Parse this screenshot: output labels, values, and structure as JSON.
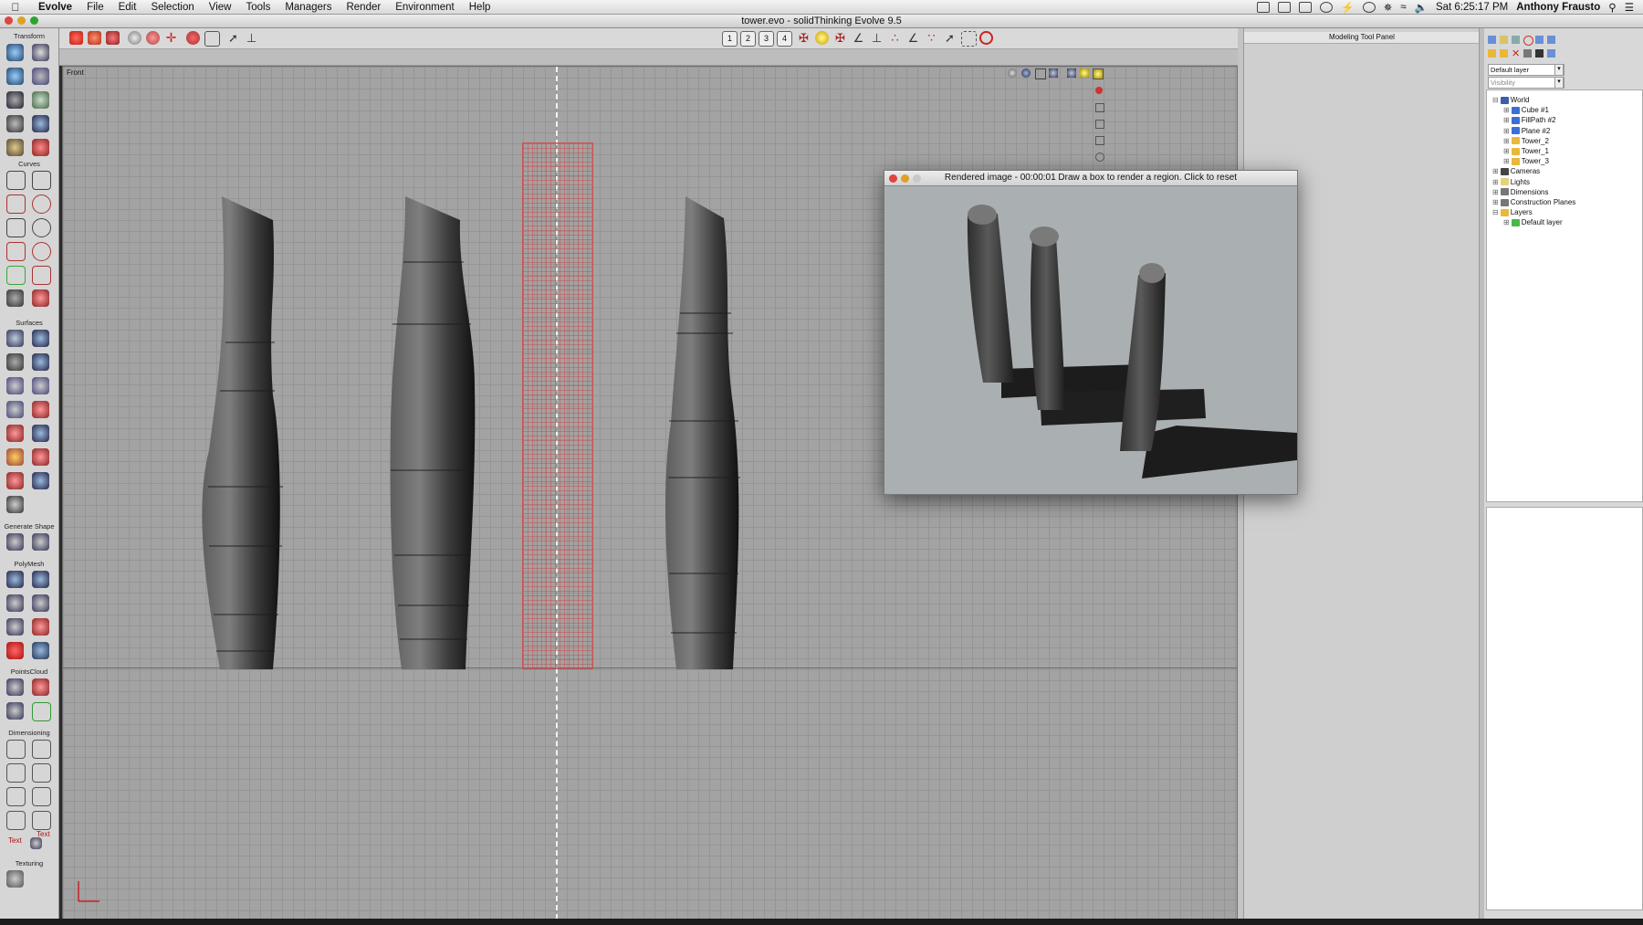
{
  "menubar": {
    "app_name": "Evolve",
    "items": [
      "File",
      "Edit",
      "Selection",
      "View",
      "Tools",
      "Managers",
      "Render",
      "Environment",
      "Help"
    ],
    "clock": "Sat 6:25:17 PM",
    "user": "Anthony Frausto"
  },
  "window": {
    "title": "tower.evo - solidThinking Evolve 9.5"
  },
  "toolbar": {
    "view_numbers": [
      "1",
      "2",
      "3",
      "4"
    ]
  },
  "left_panel": {
    "sections": [
      "Transform",
      "Curves",
      "Surfaces",
      "Generate Shape",
      "PolyMesh",
      "PointsCloud",
      "Dimensioning",
      "Texturing"
    ],
    "text_labels": [
      "Text",
      "Text"
    ]
  },
  "viewport": {
    "label": "Front"
  },
  "modeling_panel": {
    "title": "Modeling Tool Panel"
  },
  "browser": {
    "layer_select": "Default layer",
    "visibility_select": "Visibility",
    "tree": [
      {
        "label": "World",
        "level": 0,
        "icon": "world-icon",
        "color": "#3b5fa8"
      },
      {
        "label": "Cube #1",
        "level": 1,
        "icon": "cube-icon",
        "color": "#3c6fd6"
      },
      {
        "label": "FillPath #2",
        "level": 1,
        "icon": "surface-icon",
        "color": "#3c6fd6"
      },
      {
        "label": "Plane #2",
        "level": 1,
        "icon": "plane-icon",
        "color": "#3c6fd6"
      },
      {
        "label": "Tower_2",
        "level": 1,
        "icon": "folder-icon",
        "color": "#e8b83a"
      },
      {
        "label": "Tower_1",
        "level": 1,
        "icon": "folder-icon",
        "color": "#e8b83a"
      },
      {
        "label": "Tower_3",
        "level": 1,
        "icon": "folder-icon",
        "color": "#e8b83a"
      },
      {
        "label": "Cameras",
        "level": 0,
        "icon": "camera-icon",
        "color": "#444444"
      },
      {
        "label": "Lights",
        "level": 0,
        "icon": "light-icon",
        "color": "#e6d27a"
      },
      {
        "label": "Dimensions",
        "level": 0,
        "icon": "dimension-icon",
        "color": "#777777"
      },
      {
        "label": "Construction Planes",
        "level": 0,
        "icon": "plane-icon",
        "color": "#777777"
      },
      {
        "label": "Layers",
        "level": 0,
        "icon": "layers-icon",
        "color": "#e8b83a"
      },
      {
        "label": "Default layer",
        "level": 1,
        "icon": "layer-check-icon",
        "color": "#48b848"
      }
    ]
  },
  "render_window": {
    "title": "Rendered image - 00:00:01 Draw a box to render a region. Click to reset"
  }
}
